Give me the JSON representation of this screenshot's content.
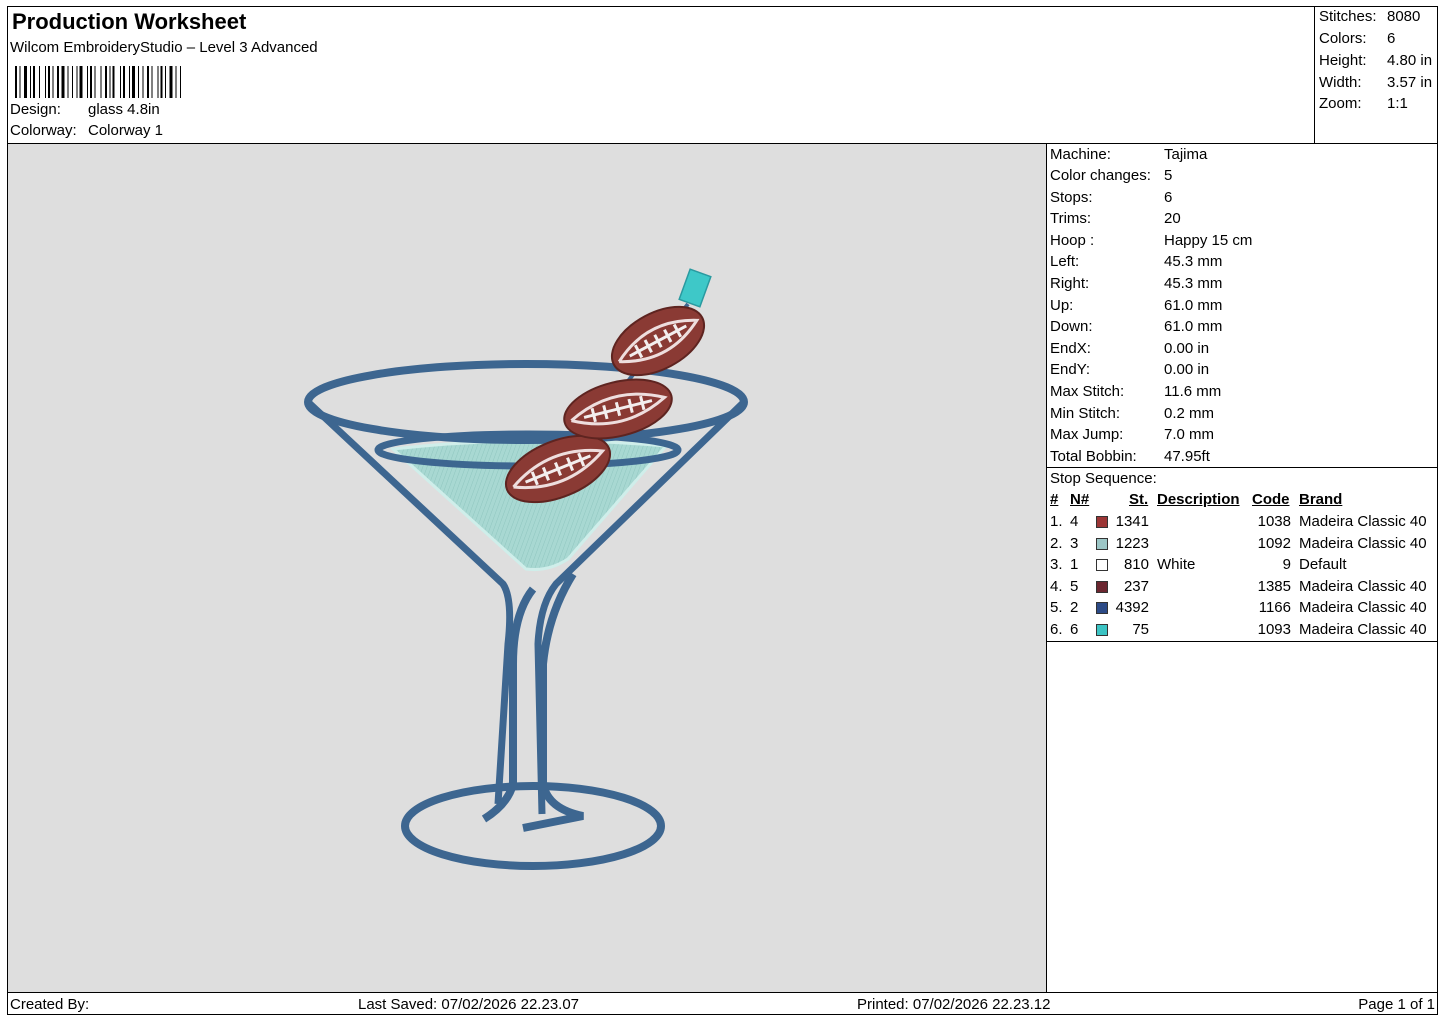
{
  "header": {
    "title": "Production Worksheet",
    "subtitle": "Wilcom EmbroideryStudio – Level 3 Advanced",
    "design_label": "Design:",
    "design_value": "glass 4.8in",
    "colorway_label": "Colorway:",
    "colorway_value": "Colorway 1"
  },
  "summary": [
    {
      "label": "Stitches:",
      "value": "8080"
    },
    {
      "label": "Colors:",
      "value": "6"
    },
    {
      "label": "Height:",
      "value": "4.80 in"
    },
    {
      "label": "Width:",
      "value": "3.57 in"
    },
    {
      "label": "Zoom:",
      "value": "1:1"
    }
  ],
  "machine_info": [
    {
      "label": "Machine:",
      "value": "Tajima"
    },
    {
      "label": "Color changes:",
      "value": "5"
    },
    {
      "label": "Stops:",
      "value": "6"
    },
    {
      "label": "Trims:",
      "value": "20"
    },
    {
      "label": "Hoop :",
      "value": "Happy 15 cm"
    },
    {
      "label": "Left:",
      "value": "45.3 mm"
    },
    {
      "label": "Right:",
      "value": "45.3 mm"
    },
    {
      "label": "Up:",
      "value": "61.0 mm"
    },
    {
      "label": "Down:",
      "value": "61.0 mm"
    },
    {
      "label": "EndX:",
      "value": "0.00 in"
    },
    {
      "label": "EndY:",
      "value": "0.00 in"
    },
    {
      "label": "Max Stitch:",
      "value": "11.6 mm"
    },
    {
      "label": "Min Stitch:",
      "value": "0.2 mm"
    },
    {
      "label": "Max Jump:",
      "value": "7.0 mm"
    },
    {
      "label": "Total Bobbin:",
      "value": "47.95ft"
    }
  ],
  "stop_sequence": {
    "title": "Stop Sequence:",
    "headers": {
      "num": "#",
      "n": "N#",
      "st": "St.",
      "description": "Description",
      "code": "Code",
      "brand": "Brand"
    },
    "rows": [
      {
        "num": "1.",
        "n": "4",
        "color": "#9b3535",
        "st": "1341",
        "description": "",
        "code": "1038",
        "brand": "Madeira Classic 40"
      },
      {
        "num": "2.",
        "n": "3",
        "color": "#9cc6c6",
        "st": "1223",
        "description": "",
        "code": "1092",
        "brand": "Madeira Classic 40"
      },
      {
        "num": "3.",
        "n": "1",
        "color": "#ffffff",
        "st": "810",
        "description": "White",
        "code": "9",
        "brand": "Default"
      },
      {
        "num": "4.",
        "n": "5",
        "color": "#6b2630",
        "st": "237",
        "description": "",
        "code": "1385",
        "brand": "Madeira Classic 40"
      },
      {
        "num": "5.",
        "n": "2",
        "color": "#2c4a86",
        "st": "4392",
        "description": "",
        "code": "1166",
        "brand": "Madeira Classic 40"
      },
      {
        "num": "6.",
        "n": "6",
        "color": "#3cc4c4",
        "st": "75",
        "description": "",
        "code": "1093",
        "brand": "Madeira Classic 40"
      }
    ]
  },
  "footer": {
    "created_by": "Created By:",
    "last_saved": "Last Saved: 07/02/2026 22.23.07",
    "printed": "Printed: 07/02/2026 22.23.12",
    "page": "Page 1 of 1"
  },
  "colors": {
    "canvas_bg": "#dedede",
    "glass_blue": "#3d6690",
    "liquid": "#a8d8d2",
    "football": "#8a3a34",
    "pick_tip": "#3ec8c8"
  }
}
